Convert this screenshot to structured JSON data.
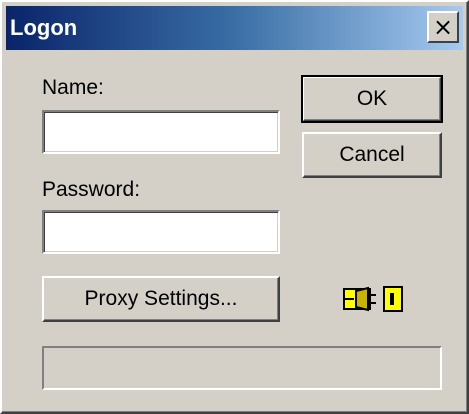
{
  "window": {
    "title": "Logon",
    "close_glyph": "×"
  },
  "form": {
    "name_label": "Name:",
    "name_value": "",
    "password_label": "Password:",
    "password_value": ""
  },
  "buttons": {
    "ok_label": "OK",
    "cancel_label": "Cancel",
    "proxy_label": "Proxy Settings..."
  },
  "status": {
    "text": "",
    "connection_icon": "plug-icon"
  },
  "colors": {
    "title_start": "#0a246a",
    "title_end": "#a6caf0",
    "face": "#d4d0c8",
    "plug_fill": "#ffff00"
  }
}
